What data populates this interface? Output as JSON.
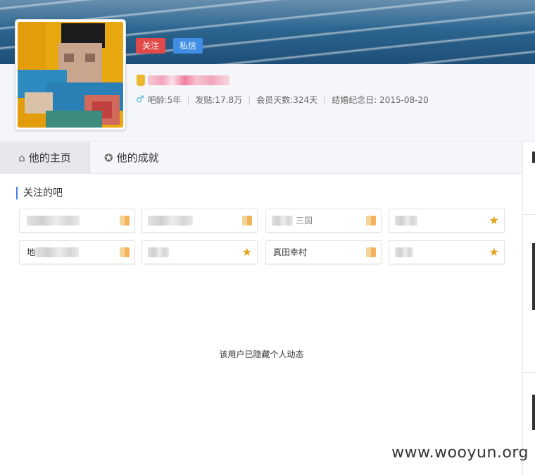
{
  "header": {
    "follow_label": "关注",
    "message_label": "私信"
  },
  "user": {
    "name_blurred": true,
    "stats": {
      "age": "吧龄:5年",
      "posts": "发贴:17.8万",
      "member_days": "会员天数:324天",
      "anniversary": "结婚纪念日: 2015-08-20"
    }
  },
  "tabs": [
    {
      "label": "他的主页",
      "icon": "home-icon"
    },
    {
      "label": "他的成就",
      "icon": "medal-icon"
    }
  ],
  "section": {
    "title": "关注的吧"
  },
  "forums": [
    {
      "name": "",
      "blurred": true,
      "level_icon": "square"
    },
    {
      "name": "",
      "blurred": true,
      "level_icon": "square"
    },
    {
      "name": "三国",
      "blurred": true,
      "level_icon": "square-up"
    },
    {
      "name": "",
      "blurred": true,
      "level_icon": "star"
    },
    {
      "name": "地",
      "blurred": true,
      "level_icon": "square"
    },
    {
      "name": "",
      "blurred": true,
      "level_icon": "star"
    },
    {
      "name": "真田幸村",
      "blurred": false,
      "level_icon": "square"
    },
    {
      "name": "",
      "blurred": true,
      "level_icon": "star"
    }
  ],
  "feed": {
    "hidden_message": "该用户已隐藏个人动态"
  },
  "watermark": "www.wooyun.org",
  "colors": {
    "follow": "#e24a49",
    "message": "#3f8de4",
    "accent": "#4a7de0",
    "level": "#e3a21a"
  }
}
